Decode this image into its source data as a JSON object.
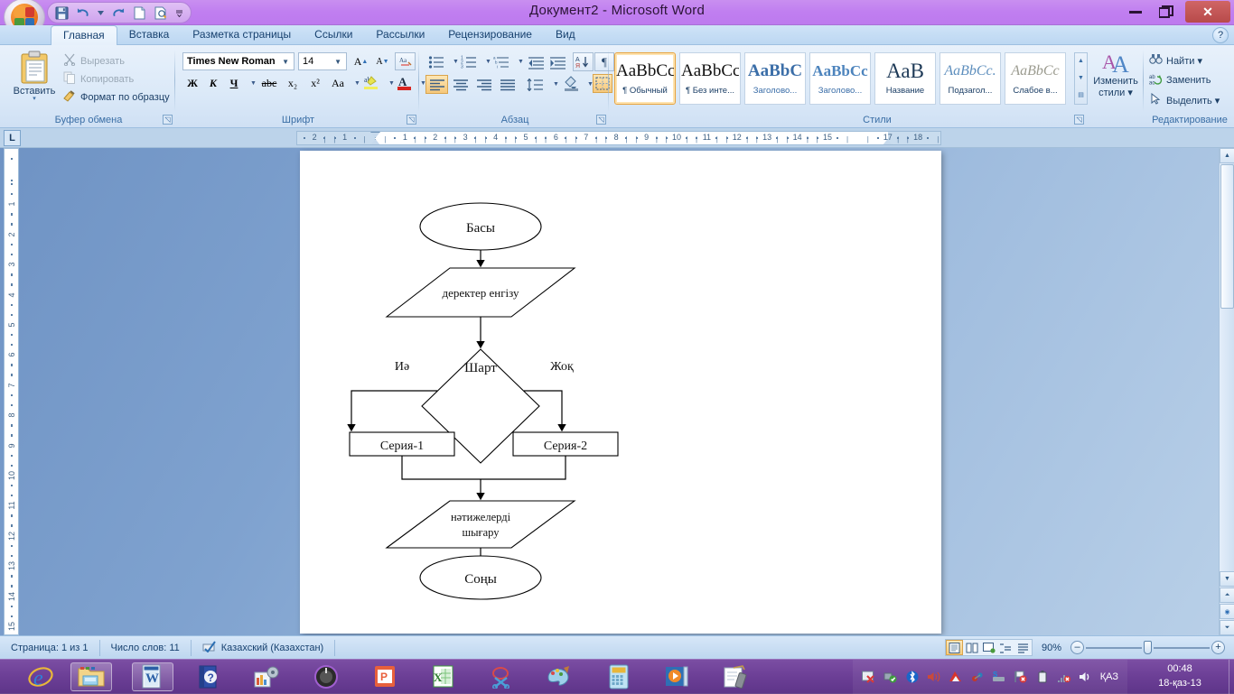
{
  "window": {
    "title": "Документ2 - Microsoft Word",
    "minimize_label": "—",
    "maximize_label": "❐",
    "close_label": "✕",
    "help_label": "?"
  },
  "quick_access": [
    {
      "name": "save-icon",
      "label": "💾"
    },
    {
      "name": "undo-icon",
      "label": "↶"
    },
    {
      "name": "undo-dropdown-icon",
      "label": "▾"
    },
    {
      "name": "redo-icon",
      "label": "↷"
    },
    {
      "name": "new-document-icon",
      "label": "🗋"
    },
    {
      "name": "print-preview-icon",
      "label": "🔍"
    },
    {
      "name": "customize-qat-icon",
      "label": "▾"
    }
  ],
  "tabs": [
    {
      "label": "Главная",
      "active": true
    },
    {
      "label": "Вставка",
      "active": false
    },
    {
      "label": "Разметка страницы",
      "active": false
    },
    {
      "label": "Ссылки",
      "active": false
    },
    {
      "label": "Рассылки",
      "active": false
    },
    {
      "label": "Рецензирование",
      "active": false
    },
    {
      "label": "Вид",
      "active": false
    }
  ],
  "ribbon": {
    "clipboard": {
      "title": "Буфер обмена",
      "paste_label": "Вставить",
      "paste_caret": "▾",
      "cut_label": "Вырезать",
      "copy_label": "Копировать",
      "format_painter_label": "Формат по образцу"
    },
    "font": {
      "title": "Шрифт",
      "font_name": "Times New Roman",
      "font_size": "14",
      "grow_label": "A",
      "shrink_label": "A",
      "clear_format_label": "Aa",
      "bold_label": "Ж",
      "italic_label": "К",
      "underline_label": "Ч",
      "strike_label": "abc",
      "subscript_label": "x₂",
      "superscript_label": "x²",
      "change_case_label": "Aa",
      "highlight_label": "ab",
      "font_color_label": "A"
    },
    "paragraph": {
      "title": "Абзац",
      "bullets_label": "≔",
      "numbering_label": "⒈",
      "multilevel_label": "⁝",
      "decrease_indent_label": "⇤",
      "increase_indent_label": "⇥",
      "sort_label": "A↓",
      "show_marks_label": "¶",
      "align_left_label": "≡",
      "align_center_label": "≡",
      "align_right_label": "≡",
      "justify_label": "≡",
      "line_spacing_label": "↕",
      "shading_label": "▨",
      "borders_label": "⊞"
    },
    "styles": {
      "title": "Стили",
      "items": [
        {
          "sample": "AaBbCс",
          "name": "¶ Обычный",
          "selected": true
        },
        {
          "sample": "AaBbCс",
          "name": "¶ Без инте...",
          "selected": false
        },
        {
          "sample": "AaBbC",
          "name": "Заголово...",
          "selected": false
        },
        {
          "sample": "AaBbCc",
          "name": "Заголово...",
          "selected": false
        },
        {
          "sample": "АаВ",
          "name": "Название",
          "selected": false
        },
        {
          "sample": "AaBbCc.",
          "name": "Подзагол...",
          "selected": false
        },
        {
          "sample": "AaBbCc",
          "name": "Слабое в...",
          "selected": false
        }
      ],
      "change_styles_line1": "Изменить",
      "change_styles_line2": "стили ▾"
    },
    "editing": {
      "title": "Редактирование",
      "find_label": "Найти ▾",
      "replace_label": "Заменить",
      "select_label": "Выделить ▾"
    }
  },
  "ruler": {
    "tab_stop_label": "L",
    "h_numbers": [
      "2",
      "1",
      "1",
      "2",
      "3",
      "4",
      "5",
      "6",
      "7",
      "8",
      "9",
      "10",
      "11",
      "12",
      "13",
      "14",
      "15",
      "17",
      "18"
    ],
    "v_numbers": [
      "1",
      "2",
      "3",
      "4",
      "5",
      "6",
      "7",
      "8",
      "9",
      "10",
      "11",
      "12",
      "13",
      "14",
      "15"
    ]
  },
  "flowchart": {
    "nodes": [
      {
        "id": "start",
        "shape": "ellipse",
        "text": "Басы"
      },
      {
        "id": "input",
        "shape": "parallelogram",
        "text": "деректер енгізу"
      },
      {
        "id": "condition",
        "shape": "diamond",
        "text": "Шарт"
      },
      {
        "id": "branch1",
        "shape": "rect",
        "text": "Серия-1"
      },
      {
        "id": "branch2",
        "shape": "rect",
        "text": "Серия-2"
      },
      {
        "id": "output",
        "shape": "parallelogram",
        "text": "нәтижелерді шығару",
        "text2": "шығару"
      },
      {
        "id": "end",
        "shape": "ellipse",
        "text": "Соңы"
      }
    ],
    "labels": {
      "yes": "Иә",
      "no": "Жоқ",
      "output_line1": "нәтижелерді",
      "output_line2": "шығару"
    }
  },
  "status_bar": {
    "page": "Страница: 1 из 1",
    "words": "Число слов: 11",
    "language": "Казахский (Казахстан)",
    "proofing_icon": "✓",
    "zoom": "90%",
    "zoom_out": "—",
    "zoom_in": "+",
    "views": [
      {
        "name": "print-layout-view",
        "label": "▤",
        "selected": true
      },
      {
        "name": "full-screen-reading-view",
        "label": "▥",
        "selected": false
      },
      {
        "name": "web-layout-view",
        "label": "▦",
        "selected": false
      },
      {
        "name": "outline-view",
        "label": "▤",
        "selected": false
      },
      {
        "name": "draft-view",
        "label": "▤",
        "selected": false
      }
    ]
  },
  "taskbar": {
    "items": [
      {
        "name": "internet-explorer-icon",
        "label": "e"
      },
      {
        "name": "windows-explorer-icon",
        "label": "📁",
        "active": true
      },
      {
        "name": "microsoft-word-icon",
        "label": "W",
        "active": true
      },
      {
        "name": "help-icon",
        "label": "?"
      },
      {
        "name": "chart-tool-icon",
        "label": "📊"
      },
      {
        "name": "media-player-icon",
        "label": "◉"
      },
      {
        "name": "powerpoint-icon",
        "label": "P"
      },
      {
        "name": "excel-icon",
        "label": "X"
      },
      {
        "name": "snipping-tool-icon",
        "label": "✂"
      },
      {
        "name": "paint-icon",
        "label": "🎨"
      },
      {
        "name": "calculator-icon",
        "label": "🖩"
      },
      {
        "name": "video-icon",
        "label": "▶"
      },
      {
        "name": "notes-icon",
        "label": "✎"
      }
    ],
    "tray": [
      {
        "name": "network-error-icon",
        "label": "✖"
      },
      {
        "name": "usb-ok-icon",
        "label": "✔"
      },
      {
        "name": "bluetooth-icon",
        "label": "ᛒ"
      },
      {
        "name": "volume-icon",
        "label": "🔊"
      },
      {
        "name": "antivirus-icon",
        "label": "▧"
      },
      {
        "name": "device-icon",
        "label": "⚙"
      },
      {
        "name": "skype-icon",
        "label": "S"
      },
      {
        "name": "flag-error-icon",
        "label": "⚑"
      },
      {
        "name": "battery-icon",
        "label": "▯"
      },
      {
        "name": "network-disconnected-icon",
        "label": "▤"
      },
      {
        "name": "speaker-icon",
        "label": "🔈"
      }
    ],
    "language": "ҚАЗ",
    "time": "00:48",
    "date": "18-қаз-13"
  }
}
